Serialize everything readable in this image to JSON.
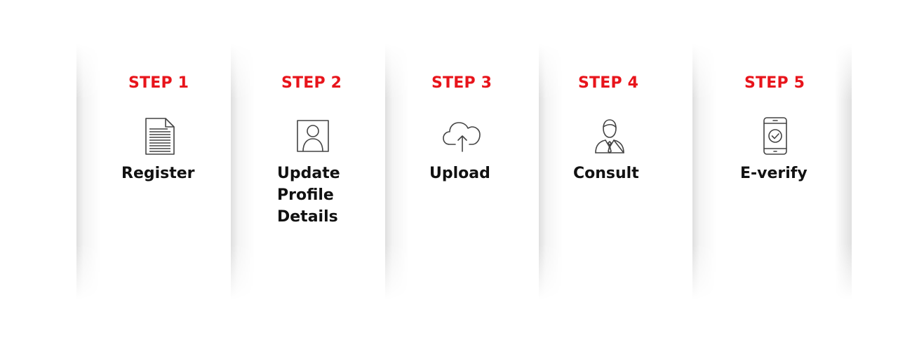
{
  "steps": [
    {
      "number": "STEP 1",
      "label": "Register",
      "icon": "document-icon"
    },
    {
      "number": "STEP 2",
      "label": "Update\nProfile\nDetails",
      "icon": "profile-photo-icon"
    },
    {
      "number": "STEP 3",
      "label": "Upload",
      "icon": "cloud-upload-icon"
    },
    {
      "number": "STEP 4",
      "label": "Consult",
      "icon": "consultant-icon"
    },
    {
      "number": "STEP 5",
      "label": "E-verify",
      "icon": "mobile-verify-icon"
    }
  ],
  "colors": {
    "step_number": "#e8141b",
    "label": "#111111",
    "icon": "#444444"
  }
}
